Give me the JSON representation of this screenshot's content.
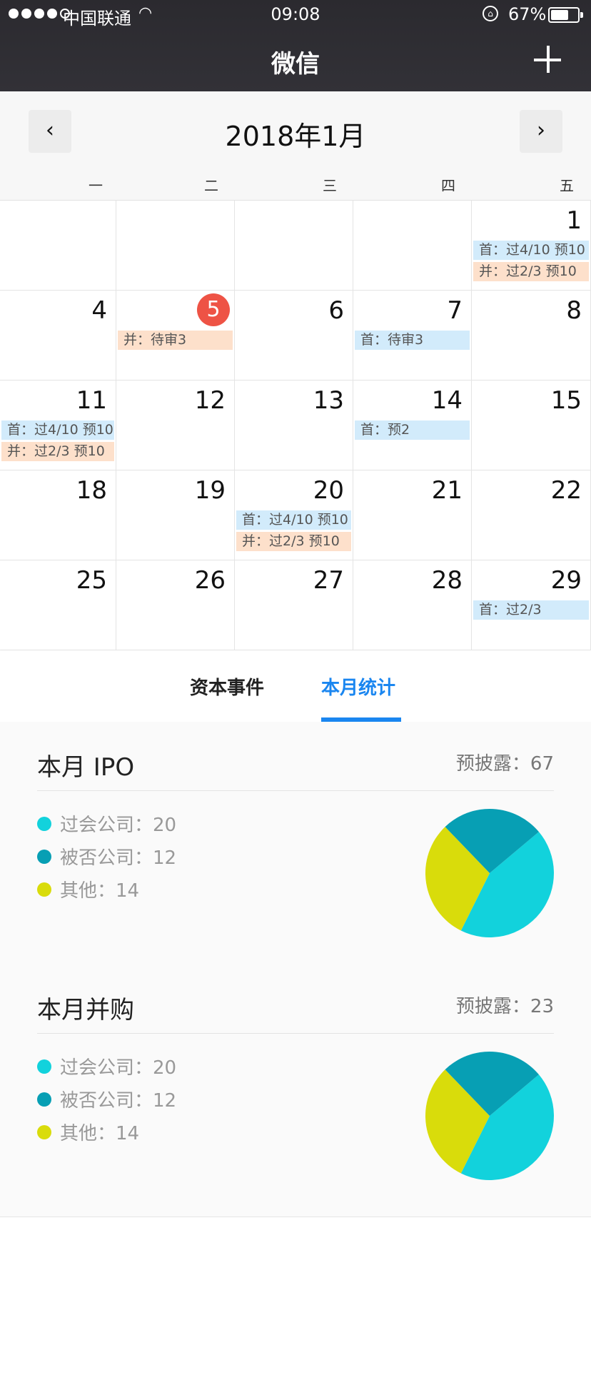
{
  "status_bar": {
    "carrier": "中国联通",
    "time": "09:08",
    "battery": "67%",
    "battery_level": 0.67
  },
  "nav": {
    "title": "微信"
  },
  "calendar": {
    "month_label": "2018年1月",
    "prev": "‹",
    "next": "›",
    "weekdays": [
      "一",
      "二",
      "三",
      "四",
      "五"
    ],
    "today_day": 5,
    "weeks": [
      [
        {
          "day": "",
          "events": []
        },
        {
          "day": "",
          "events": []
        },
        {
          "day": "",
          "events": []
        },
        {
          "day": "",
          "events": []
        },
        {
          "day": "1",
          "events": [
            {
              "type": "blue",
              "text": "首：过4/10 预10"
            },
            {
              "type": "orange",
              "text": "并：过2/3 预10"
            }
          ]
        }
      ],
      [
        {
          "day": "4",
          "events": []
        },
        {
          "day": "5",
          "events": [
            {
              "type": "orange",
              "text": "并：待审3"
            }
          ]
        },
        {
          "day": "6",
          "events": []
        },
        {
          "day": "7",
          "events": [
            {
              "type": "blue",
              "text": "首：待审3"
            }
          ]
        },
        {
          "day": "8",
          "events": []
        }
      ],
      [
        {
          "day": "11",
          "events": [
            {
              "type": "blue",
              "text": "首：过4/10 预10"
            },
            {
              "type": "orange",
              "text": "并：过2/3 预10"
            }
          ]
        },
        {
          "day": "12",
          "events": []
        },
        {
          "day": "13",
          "events": []
        },
        {
          "day": "14",
          "events": [
            {
              "type": "blue",
              "text": "首：预2"
            }
          ]
        },
        {
          "day": "15",
          "events": []
        }
      ],
      [
        {
          "day": "18",
          "events": []
        },
        {
          "day": "19",
          "events": []
        },
        {
          "day": "20",
          "events": [
            {
              "type": "blue",
              "text": "首：过4/10 预10"
            },
            {
              "type": "orange",
              "text": "并：过2/3 预10"
            }
          ]
        },
        {
          "day": "21",
          "events": []
        },
        {
          "day": "22",
          "events": []
        }
      ],
      [
        {
          "day": "25",
          "events": []
        },
        {
          "day": "26",
          "events": []
        },
        {
          "day": "27",
          "events": []
        },
        {
          "day": "28",
          "events": []
        },
        {
          "day": "29",
          "events": [
            {
              "type": "blue",
              "text": "首：过2/3"
            }
          ]
        }
      ]
    ]
  },
  "tabs": [
    {
      "label": "资本事件",
      "active": false
    },
    {
      "label": "本月统计",
      "active": true
    }
  ],
  "colors": {
    "passed": "#12d2dc",
    "rejected": "#079fb4",
    "other": "#d9dc0b",
    "accent": "#1a86f0",
    "today": "#ee5345",
    "event_blue": "#d2ebfb",
    "event_orange": "#fde0cb"
  },
  "stats": [
    {
      "title": "本月 IPO",
      "predisclosure": "预披露：67",
      "items": [
        {
          "label": "过会公司：20",
          "value": 20,
          "color": "#12d2dc"
        },
        {
          "label": "被否公司：12",
          "value": 12,
          "color": "#079fb4"
        },
        {
          "label": "其他：14",
          "value": 14,
          "color": "#d9dc0b"
        }
      ]
    },
    {
      "title": "本月并购",
      "predisclosure": "预披露：23",
      "items": [
        {
          "label": "过会公司：20",
          "value": 20,
          "color": "#12d2dc"
        },
        {
          "label": "被否公司：12",
          "value": 12,
          "color": "#079fb4"
        },
        {
          "label": "其他：14",
          "value": 14,
          "color": "#d9dc0b"
        }
      ]
    }
  ]
}
